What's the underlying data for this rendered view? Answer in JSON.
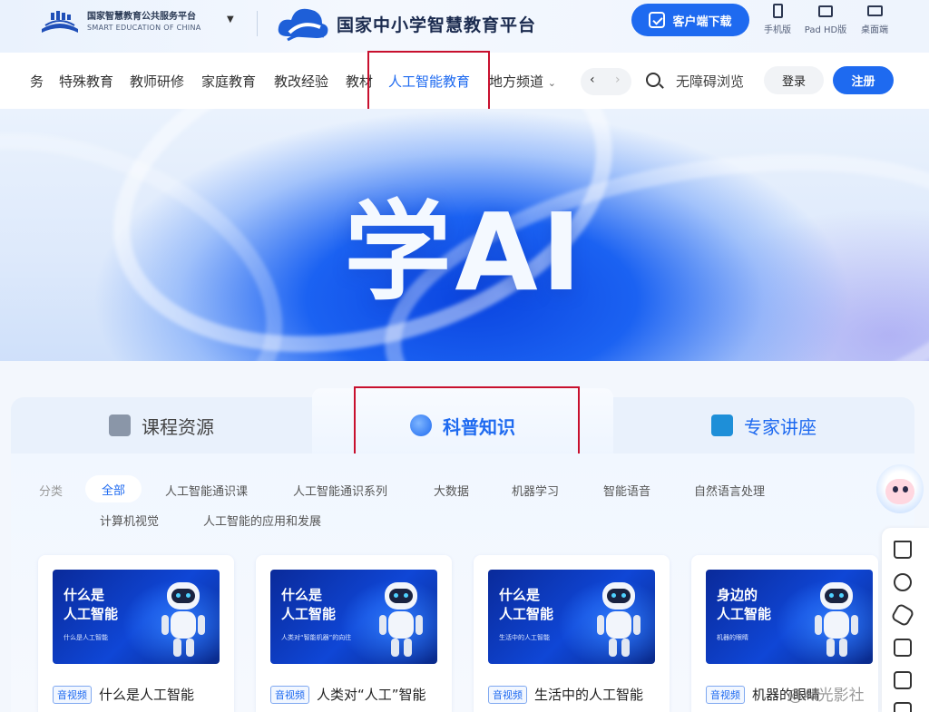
{
  "header": {
    "org_name_cn": "国家智慧教育公共服务平台",
    "org_name_en": "SMART EDUCATION OF CHINA",
    "platform_name": "国家中小学智慧教育平台",
    "download_button": "客户端下载",
    "devices": [
      {
        "label": "手机版",
        "icon": "phone-icon"
      },
      {
        "label": "Pad HD版",
        "icon": "tablet-icon"
      },
      {
        "label": "桌面端",
        "icon": "desktop-icon"
      }
    ]
  },
  "nav": {
    "items": [
      "务",
      "特殊教育",
      "教师研修",
      "家庭教育",
      "教改经验",
      "教材",
      "人工智能教育",
      "地方频道"
    ],
    "active_item": "人工智能教育",
    "dropdown_caret": "⌄",
    "prev_arrow": "‹",
    "next_arrow": "›",
    "accessibility": "无障碍浏览",
    "login": "登录",
    "register": "注册"
  },
  "banner": {
    "title": "学AI"
  },
  "tabs": {
    "items": [
      {
        "label": "课程资源",
        "icon": "document-icon"
      },
      {
        "label": "科普知识",
        "icon": "planet-icon"
      },
      {
        "label": "专家讲座",
        "icon": "chat-icon"
      }
    ],
    "active": "科普知识"
  },
  "categories": {
    "label": "分类",
    "items": [
      "全部",
      "人工智能通识课",
      "人工智能通识系列",
      "大数据",
      "机器学习",
      "智能语音",
      "自然语言处理",
      "计算机视觉",
      "人工智能的应用和发展"
    ],
    "selected": "全部"
  },
  "cards": [
    {
      "thumb_title": [
        "什么是",
        "人工智能"
      ],
      "thumb_sub": "什么是人工智能",
      "badge": "音视频",
      "title": "什么是人工智能"
    },
    {
      "thumb_title": [
        "什么是",
        "人工智能"
      ],
      "thumb_sub": "人类对“智能机器”的向往",
      "badge": "音视频",
      "title": "人类对“人工”智能"
    },
    {
      "thumb_title": [
        "什么是",
        "人工智能"
      ],
      "thumb_sub": "生活中的人工智能",
      "badge": "音视频",
      "title": "生活中的人工智能"
    },
    {
      "thumb_title": [
        "身边的",
        "人工智能"
      ],
      "thumb_sub": "机器的眼睛",
      "badge": "音视频",
      "title": "机器的眼睛"
    }
  ],
  "watermark": "@AI光影社",
  "colors": {
    "accent": "#1e6af0",
    "highlight_box": "#c8102e",
    "text": "#333333"
  }
}
